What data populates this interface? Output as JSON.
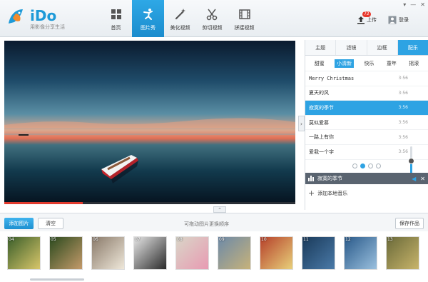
{
  "app": {
    "name": "iDo",
    "slogan": "用影像分享生活"
  },
  "nav": {
    "items": [
      {
        "label": "首页",
        "icon": "grid-icon"
      },
      {
        "label": "图片秀",
        "icon": "dancer-icon",
        "active": true
      },
      {
        "label": "美化视频",
        "icon": "magic-wand-icon"
      },
      {
        "label": "剪切视频",
        "icon": "scissors-icon"
      },
      {
        "label": "拼接视频",
        "icon": "film-icon"
      }
    ]
  },
  "header": {
    "upload_label": "上传",
    "upload_badge": "72",
    "login_label": "登录",
    "window_controls": [
      "▾",
      "—",
      "✕"
    ]
  },
  "preview": {
    "progress_fraction": 0.27
  },
  "music": {
    "tabs": [
      "主题",
      "滤镜",
      "边框",
      "配乐"
    ],
    "active_tab": 3,
    "genres": [
      "甜蜜",
      "小清新",
      "快乐",
      "童年",
      "摇滚"
    ],
    "active_genre": 1,
    "tracks": [
      {
        "title": "Merry Christmas",
        "duration": "3:56"
      },
      {
        "title": "夏天的风",
        "duration": "3:56"
      },
      {
        "title": "寂寞的季节",
        "duration": "3:56",
        "active": true
      },
      {
        "title": "莫似爱慕",
        "duration": "3:56"
      },
      {
        "title": "一路上有你",
        "duration": "3:56"
      },
      {
        "title": "爱我一个字",
        "duration": "3:56"
      }
    ],
    "page_count": 4,
    "current_page": 1,
    "volume_fraction": 0.45,
    "now_playing": "寂寞的季节",
    "add_local_label": "添加本地音乐"
  },
  "toolbar": {
    "add_images_label": "添加图片",
    "clear_label": "清空",
    "hint": "可拖动图片更换顺序",
    "save_label": "保存作品"
  },
  "filmstrip": {
    "thumbs": [
      "04",
      "05",
      "06",
      "07",
      "08",
      "09",
      "10",
      "11",
      "12",
      "13"
    ]
  },
  "colors": {
    "accent": "#2ea3e3",
    "brand": "#1d9ad8",
    "progress": "#e23b2e"
  }
}
